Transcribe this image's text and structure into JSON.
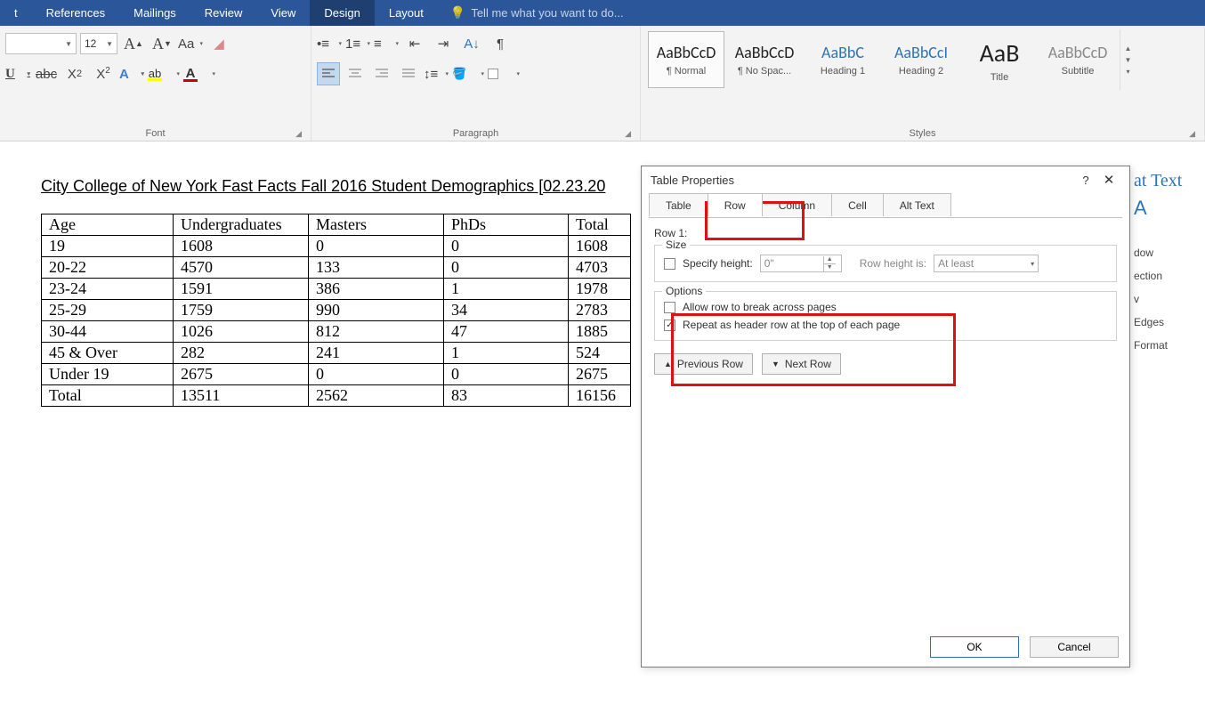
{
  "ribbon": {
    "tabs": [
      "t",
      "References",
      "Mailings",
      "Review",
      "View",
      "Design",
      "Layout"
    ],
    "active_tab": "Design",
    "tell_me": "Tell me what you want to do...",
    "font_size": "12",
    "groups": {
      "font": "Font",
      "paragraph": "Paragraph",
      "styles": "Styles"
    },
    "style_items": [
      {
        "preview": "AaBbCcD",
        "name": "¶ Normal"
      },
      {
        "preview": "AaBbCcD",
        "name": "¶ No Spac..."
      },
      {
        "preview": "AaBbC",
        "name": "Heading 1"
      },
      {
        "preview": "AaBbCcI",
        "name": "Heading 2"
      },
      {
        "preview": "AaB",
        "name": "Title"
      },
      {
        "preview": "AaBbCcD",
        "name": "Subtitle"
      }
    ]
  },
  "document": {
    "heading": "City College of New York Fast Facts Fall 2016 Student Demographics [02.23.20",
    "columns": [
      "Age",
      "Undergraduates",
      "Masters",
      "PhDs",
      "Total"
    ],
    "rows": [
      [
        "19",
        "1608",
        "0",
        "0",
        "1608"
      ],
      [
        "20-22",
        "4570",
        "133",
        "0",
        "4703"
      ],
      [
        "23-24",
        "1591",
        "386",
        "1",
        "1978"
      ],
      [
        "25-29",
        "1759",
        "990",
        "34",
        "2783"
      ],
      [
        "30-44",
        "1026",
        "812",
        "47",
        "1885"
      ],
      [
        "45 & Over",
        "282",
        "241",
        "1",
        "524"
      ],
      [
        "Under 19",
        "2675",
        "0",
        "0",
        "2675"
      ],
      [
        "Total",
        "13511",
        "2562",
        "83",
        "16156"
      ]
    ]
  },
  "dialog": {
    "title": "Table Properties",
    "tabs": [
      "Table",
      "Row",
      "Column",
      "Cell",
      "Alt Text"
    ],
    "active_tab": "Row",
    "row_label": "Row 1:",
    "size_legend": "Size",
    "specify_height": "Specify height:",
    "height_value": "0\"",
    "row_height_is": "Row height is:",
    "at_least": "At least",
    "options_legend": "Options",
    "allow_break": "Allow row to break across pages",
    "allow_break_checked": false,
    "repeat_header": "Repeat as header row at the top of each page",
    "repeat_header_checked": true,
    "prev_row": "Previous Row",
    "next_row": "Next Row",
    "ok": "OK",
    "cancel": "Cancel",
    "help": "?"
  },
  "side_pane": {
    "title": "at Text",
    "items": [
      "dow",
      "ection",
      "v",
      "Edges",
      "Format"
    ]
  }
}
